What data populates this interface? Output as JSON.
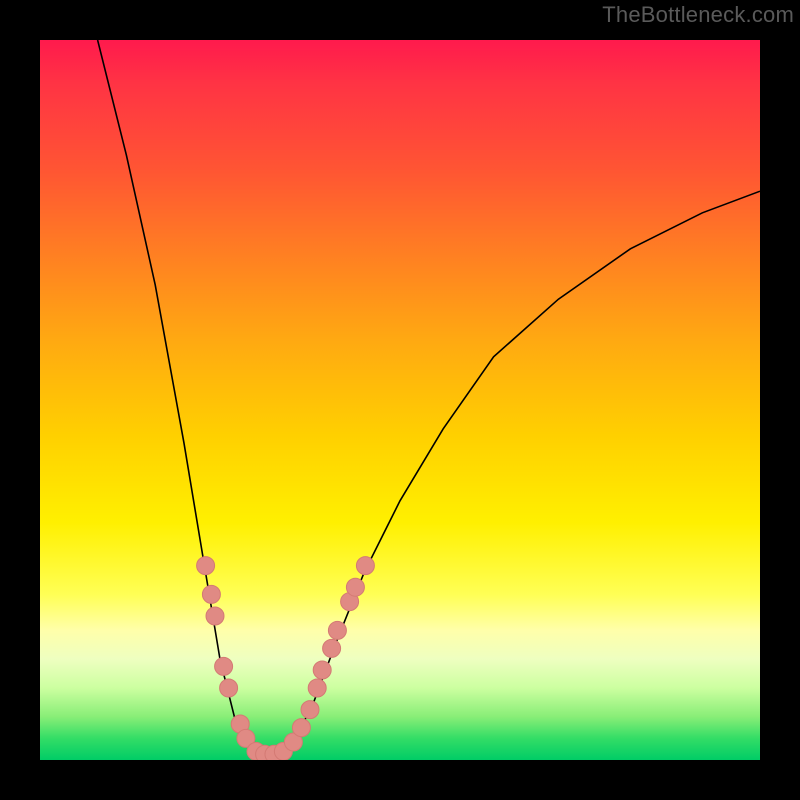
{
  "watermark": "TheBottleneck.com",
  "colors": {
    "frame": "#000000",
    "curve": "#000000",
    "marker_fill": "#e08a84",
    "marker_stroke": "#d47a74",
    "gradient_stops": [
      {
        "offset": 0.0,
        "color": "#ff1a4d"
      },
      {
        "offset": 0.06,
        "color": "#ff3344"
      },
      {
        "offset": 0.18,
        "color": "#ff5533"
      },
      {
        "offset": 0.3,
        "color": "#ff8022"
      },
      {
        "offset": 0.42,
        "color": "#ffaa11"
      },
      {
        "offset": 0.55,
        "color": "#ffd000"
      },
      {
        "offset": 0.67,
        "color": "#fff000"
      },
      {
        "offset": 0.77,
        "color": "#ffff55"
      },
      {
        "offset": 0.82,
        "color": "#ffffaa"
      },
      {
        "offset": 0.86,
        "color": "#eeffc0"
      },
      {
        "offset": 0.9,
        "color": "#ccffa0"
      },
      {
        "offset": 0.94,
        "color": "#88ee77"
      },
      {
        "offset": 0.97,
        "color": "#33dd66"
      },
      {
        "offset": 1.0,
        "color": "#00cc66"
      }
    ]
  },
  "chart_data": {
    "type": "line",
    "title": "",
    "xlabel": "",
    "ylabel": "",
    "xlim": [
      0,
      100
    ],
    "ylim": [
      0,
      100
    ],
    "series": [
      {
        "name": "bottleneck-curve",
        "points": [
          {
            "x": 8,
            "y": 100
          },
          {
            "x": 12,
            "y": 84
          },
          {
            "x": 16,
            "y": 66
          },
          {
            "x": 20,
            "y": 44
          },
          {
            "x": 23,
            "y": 26
          },
          {
            "x": 25,
            "y": 14
          },
          {
            "x": 27,
            "y": 6
          },
          {
            "x": 29,
            "y": 2
          },
          {
            "x": 31,
            "y": 0.5
          },
          {
            "x": 33,
            "y": 0.5
          },
          {
            "x": 35,
            "y": 2
          },
          {
            "x": 38,
            "y": 8
          },
          {
            "x": 41,
            "y": 16
          },
          {
            "x": 45,
            "y": 26
          },
          {
            "x": 50,
            "y": 36
          },
          {
            "x": 56,
            "y": 46
          },
          {
            "x": 63,
            "y": 56
          },
          {
            "x": 72,
            "y": 64
          },
          {
            "x": 82,
            "y": 71
          },
          {
            "x": 92,
            "y": 76
          },
          {
            "x": 100,
            "y": 79
          }
        ]
      }
    ],
    "markers": [
      {
        "x": 23.0,
        "y": 27
      },
      {
        "x": 23.8,
        "y": 23
      },
      {
        "x": 24.3,
        "y": 20
      },
      {
        "x": 25.5,
        "y": 13
      },
      {
        "x": 26.2,
        "y": 10
      },
      {
        "x": 27.8,
        "y": 5
      },
      {
        "x": 28.6,
        "y": 3
      },
      {
        "x": 30.0,
        "y": 1.2
      },
      {
        "x": 31.2,
        "y": 0.8
      },
      {
        "x": 32.5,
        "y": 0.8
      },
      {
        "x": 33.8,
        "y": 1.2
      },
      {
        "x": 35.2,
        "y": 2.5
      },
      {
        "x": 36.3,
        "y": 4.5
      },
      {
        "x": 37.5,
        "y": 7
      },
      {
        "x": 38.5,
        "y": 10
      },
      {
        "x": 39.2,
        "y": 12.5
      },
      {
        "x": 40.5,
        "y": 15.5
      },
      {
        "x": 41.3,
        "y": 18
      },
      {
        "x": 43.0,
        "y": 22
      },
      {
        "x": 43.8,
        "y": 24
      },
      {
        "x": 45.2,
        "y": 27
      }
    ]
  }
}
